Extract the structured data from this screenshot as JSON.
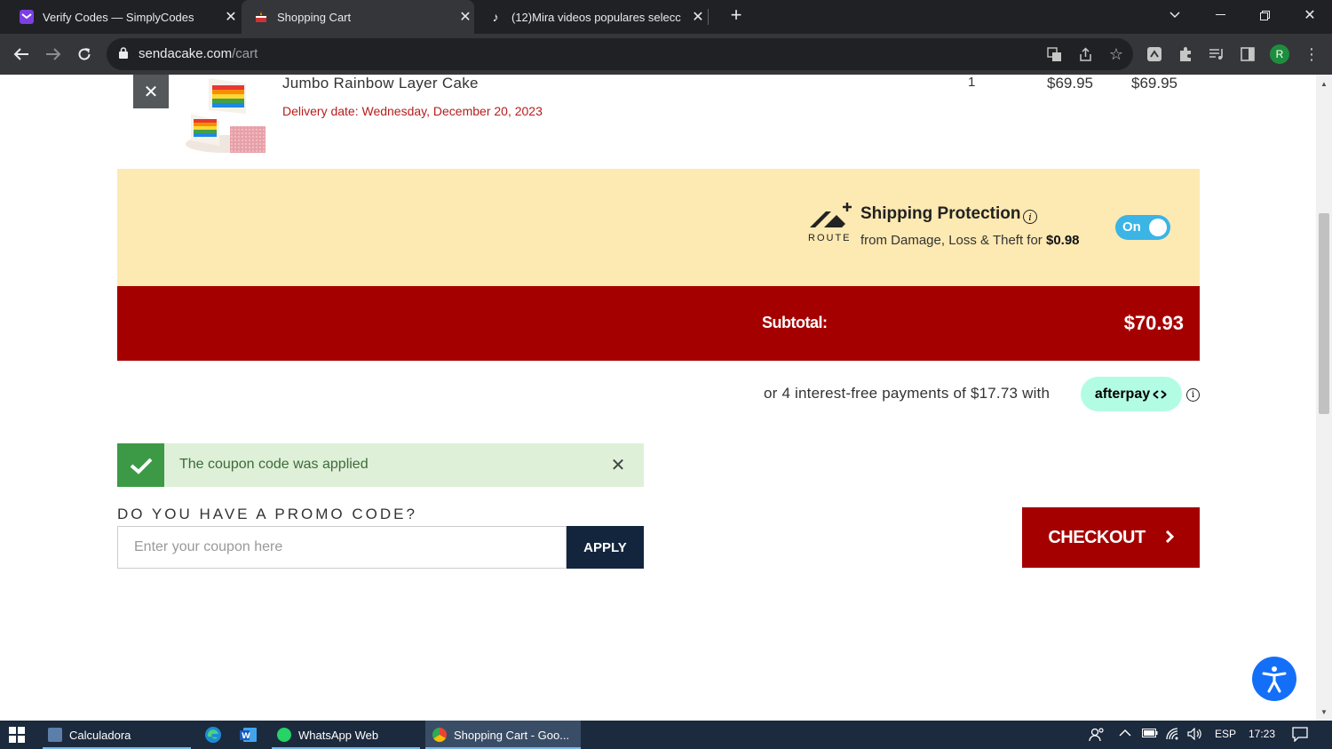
{
  "browser": {
    "tabs": [
      {
        "title": "Verify Codes — SimplyCodes",
        "active": false
      },
      {
        "title": "Shopping Cart",
        "active": true
      },
      {
        "title": "(12)Mira videos populares selecc",
        "active": false
      }
    ],
    "url_domain": "sendacake.com",
    "url_path": "/cart",
    "profile_initial": "R"
  },
  "cart": {
    "item": {
      "name": "Jumbo Rainbow Layer Cake",
      "delivery": "Delivery date: Wednesday, December 20, 2023",
      "quantity": "1",
      "unit_price": "$69.95",
      "total_price": "$69.95"
    },
    "protection": {
      "brand": "ROUTE",
      "title": "Shipping Protection",
      "subtitle_prefix": "from Damage, Loss & Theft for",
      "price": "$0.98",
      "toggle_label": "On",
      "toggle_on": true
    },
    "subtotal_label": "Subtotal:",
    "subtotal_value": "$70.93",
    "afterpay_text": "or 4 interest-free payments of $17.73 with",
    "afterpay_brand": "afterpay"
  },
  "coupon": {
    "message": "The coupon code was applied",
    "promo_label": "DO YOU HAVE A PROMO CODE?",
    "placeholder": "Enter your coupon here",
    "apply_label": "APPLY"
  },
  "checkout_label": "CHECKOUT",
  "taskbar": {
    "items": [
      "Calculadora",
      "WhatsApp Web",
      "Shopping Cart - Goo..."
    ],
    "language": "ESP",
    "time": "17:23"
  },
  "colors": {
    "brand_red": "#a50000",
    "protection_bg": "#fde9b2",
    "toggle": "#3bb4e6",
    "navy": "#13253d",
    "afterpay_mint": "#b2fce4"
  }
}
